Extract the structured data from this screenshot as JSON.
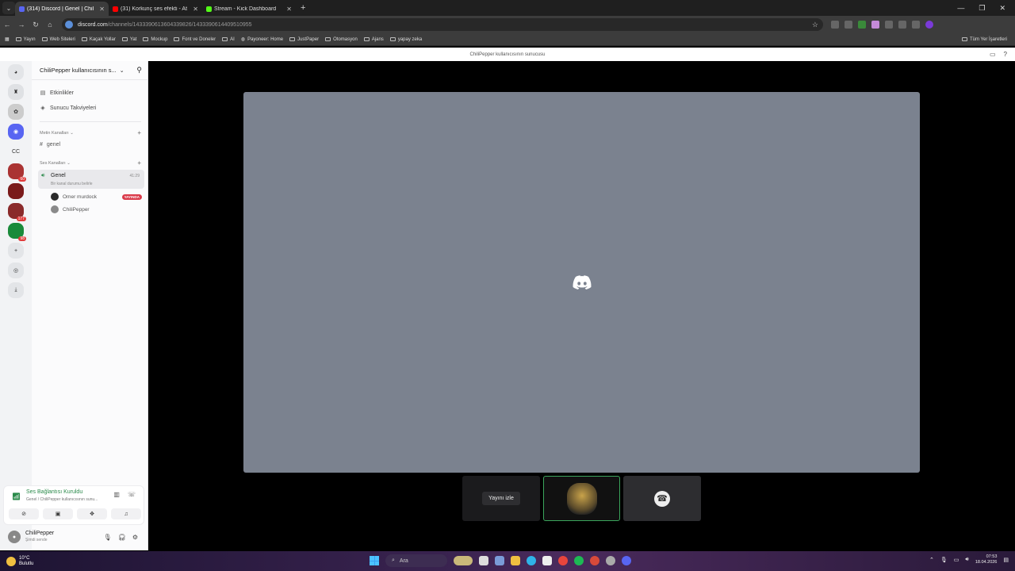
{
  "browser": {
    "tabs": [
      {
        "title": "(314) Discord | Genel | Chil",
        "active": true,
        "color": "#5865f2"
      },
      {
        "title": "(31) Korkunç ses efekti - At",
        "active": false,
        "color": "#ff0000"
      },
      {
        "title": "Stream - Kick Dashboard",
        "active": false,
        "color": "#53fc18"
      }
    ],
    "url_host": "discord.com",
    "url_path": "/channels/1433390613604339826/1433390614409510955",
    "bookmarks": [
      "Yayın",
      "Web Siteleri",
      "Kaçak Yollar",
      "Yat",
      "Mockup",
      "Font ve Doneler",
      "AI",
      "Payoneer: Home",
      "JustPaper",
      "Otomasyon",
      "Ajans",
      "yapay zeka"
    ],
    "bookmarks_right": "Tüm Yer İşaretleri"
  },
  "discord": {
    "window_title": "ChiliPepper kullanıcısının sunucusu",
    "server_name": "ChiliPepper kullanıcısının s...",
    "nav": [
      {
        "label": "Etkinlikler",
        "icon": "calendar-icon"
      },
      {
        "label": "Sunucu Takviyeleri",
        "icon": "boost-icon"
      }
    ],
    "text_category": "Metin Kanalları",
    "text_channels": [
      "genel"
    ],
    "voice_category": "Ses Kanalları",
    "voice_channel": {
      "name": "Genel",
      "time": "41:29",
      "status": "Bir kanal durumu belirle",
      "members": [
        {
          "name": "Omer murdock",
          "live_badge": "YAYINDA",
          "avatar_color": "#2a2a2a"
        },
        {
          "name": "ChiliPepper",
          "live_badge": "",
          "avatar_color": "#8a8a8a"
        }
      ]
    },
    "voice_panel": {
      "status": "Ses Bağlantısı Kuruldu",
      "sub": "Genel / ChiliPepper kullanıcısının sunu..."
    },
    "user": {
      "name": "ChiliPepper",
      "status": "Şimdi sende"
    },
    "stage": {
      "watch_button": "Yayını izle"
    },
    "servers": [
      {
        "label": "",
        "icon": "discord-home-icon",
        "badge": ""
      },
      {
        "label": "",
        "icon": "server-icon",
        "badge": ""
      },
      {
        "label": "",
        "icon": "server-icon",
        "badge": ""
      },
      {
        "label": "",
        "icon": "server-icon",
        "badge": ""
      },
      {
        "label": "CC",
        "icon": "",
        "badge": ""
      },
      {
        "label": "",
        "icon": "server-icon",
        "badge": "60"
      },
      {
        "label": "",
        "icon": "server-icon",
        "badge": ""
      },
      {
        "label": "",
        "icon": "server-icon",
        "badge": "177"
      },
      {
        "label": "",
        "icon": "server-icon",
        "badge": "98"
      }
    ]
  },
  "taskbar": {
    "weather_temp": "10°C",
    "weather_desc": "Bulutlu",
    "search_placeholder": "Ara",
    "time": "07:53",
    "date": "18.04.2026"
  }
}
